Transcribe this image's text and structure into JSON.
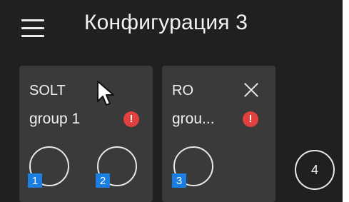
{
  "header": {
    "title": "Конфигурация 3"
  },
  "icons": {
    "menu": "hamburger-menu-icon",
    "alert": "exclamation-circle-icon",
    "close": "close-icon"
  },
  "colors": {
    "background": "#202020",
    "card": "#3a3a3a",
    "alert": "#e0413e",
    "port_badge": "#1a7fe0",
    "text": "#f0f0f0"
  },
  "cards": [
    {
      "name": "SOLT",
      "group": "group 1",
      "alert": "!",
      "ports": [
        "1",
        "2"
      ]
    },
    {
      "name": "RO",
      "group": "grou...",
      "alert": "!",
      "ports": [
        "3"
      ]
    }
  ],
  "free_port": "4"
}
